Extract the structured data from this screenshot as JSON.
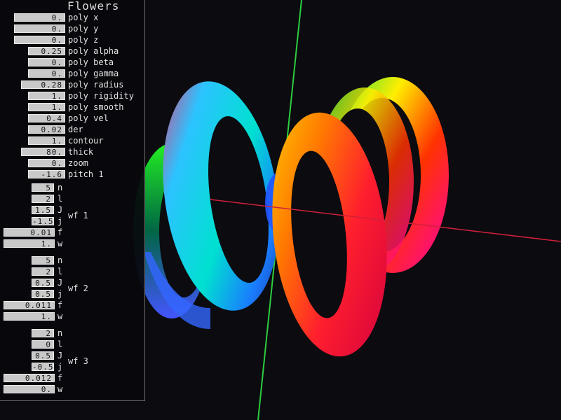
{
  "panel": {
    "title": "Flowers",
    "params": [
      {
        "value": "0.",
        "label": "poly x"
      },
      {
        "value": "0.",
        "label": "poly y"
      },
      {
        "value": "0.",
        "label": "poly z"
      },
      {
        "value": "0.25",
        "label": "poly alpha"
      },
      {
        "value": "0.",
        "label": "poly beta"
      },
      {
        "value": "0.",
        "label": "poly gamma"
      },
      {
        "value": "0.28",
        "label": "poly radius"
      },
      {
        "value": "1.",
        "label": "poly rigidity"
      },
      {
        "value": "1.",
        "label": "poly smooth"
      },
      {
        "value": "0.4",
        "label": "poly vel"
      },
      {
        "value": "0.02",
        "label": "der"
      },
      {
        "value": "1.",
        "label": "contour"
      },
      {
        "value": "80.",
        "label": "thick"
      },
      {
        "value": "0.",
        "label": "zoom"
      },
      {
        "value": "-1.6",
        "label": "pitch 1"
      }
    ],
    "wavefunctions": [
      {
        "name": "wf 1",
        "n": "5",
        "l": "2",
        "J": "1.5",
        "j": "-1.5",
        "f": "0.01",
        "w": "1."
      },
      {
        "name": "wf 2",
        "n": "5",
        "l": "2",
        "J": "0.5",
        "j": "0.5",
        "f": "0.011",
        "w": "1."
      },
      {
        "name": "wf 3",
        "n": "2",
        "l": "0",
        "J": "0.5",
        "j": "-0.5",
        "f": "0.012",
        "w": "0."
      }
    ],
    "sub_labels": {
      "n": "n",
      "l": "l",
      "J": "J",
      "j": "j",
      "f": "f",
      "w": "w"
    }
  },
  "colors": {
    "background": "#0b0b10",
    "axis_green": "#2ecc40",
    "axis_red": "#d0203a",
    "field_bg": "#c9c9c9"
  }
}
